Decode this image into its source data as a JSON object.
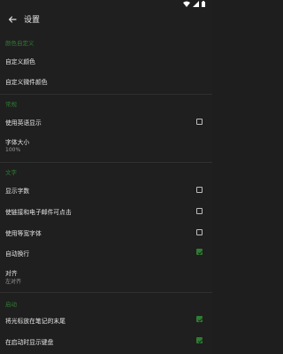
{
  "appbar": {
    "title": "设置"
  },
  "sections": {
    "custom_colors": {
      "header": "颜色自定义",
      "items": [
        "自定义颜色",
        "自定义微件颜色"
      ]
    },
    "general": {
      "header": "常规",
      "use_english": "使用英语显示",
      "font_size_label": "字体大小",
      "font_size_value": "100%"
    },
    "text": {
      "header": "文字",
      "show_word_count": "显示字数",
      "clickable_links": "使链接和电子邮件可点击",
      "monospace": "使用等宽字体",
      "word_wrap": "自动换行",
      "align_label": "对齐",
      "align_value": "左对齐"
    },
    "startup": {
      "header": "启动",
      "cursor_end": "将光标放在笔记的末尾",
      "show_keyboard": "在启动时显示键盘"
    }
  },
  "checkboxes": {
    "use_english": false,
    "show_word_count": false,
    "clickable_links": false,
    "monospace": false,
    "word_wrap": true,
    "cursor_end": true,
    "show_keyboard": true
  },
  "colors": {
    "accent": "#2e7d32",
    "background": "#1f1f1f"
  }
}
